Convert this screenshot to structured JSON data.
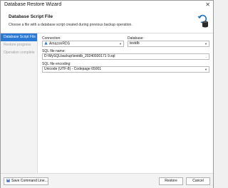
{
  "window": {
    "title": "Database Restore Wizard",
    "close_glyph": "✕"
  },
  "header": {
    "title": "Database Script File",
    "description": "Choose a file with a database script created during previous backup operation.",
    "icon": "database-restore-icon"
  },
  "steps": [
    {
      "label": "Database Script File",
      "active": true
    },
    {
      "label": "Restore progress",
      "active": false
    },
    {
      "label": "Operation complete",
      "active": false
    }
  ],
  "form": {
    "connection_label": "Connection:",
    "connection_value": "AmazonRDS",
    "database_label": "Database:",
    "database_value": "testdb",
    "sqlfile_label": "SQL file name:",
    "sqlfile_value": "D:\\MySQLbackup\\testdb_20240930171 9.sql",
    "encoding_label": "SQL file encoding:",
    "encoding_value": "Unicode (UTF-8) - Codepage 65001",
    "browse_glyph": "...",
    "dropdown_glyph": "▼"
  },
  "footer": {
    "save_label": "Save Command Line...",
    "restore_label": "Restore",
    "cancel_label": "Cancel"
  },
  "colors": {
    "accent": "#2a7ad5",
    "icon_blue": "#1a6fc2"
  }
}
